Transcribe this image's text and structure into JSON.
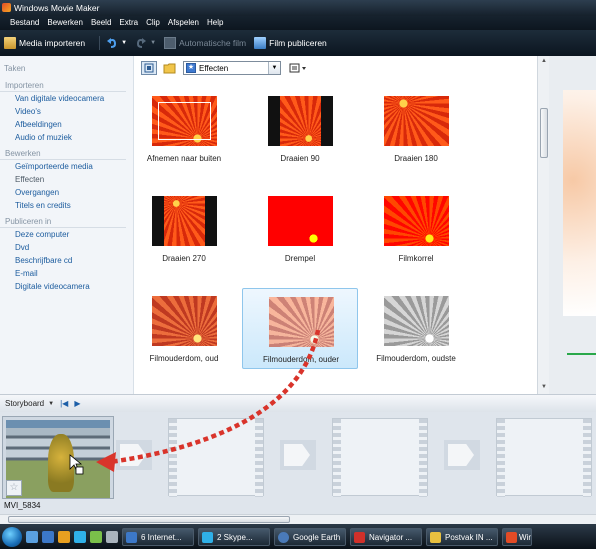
{
  "window": {
    "title": "Windows Movie Maker"
  },
  "menu": [
    "Bestand",
    "Bewerken",
    "Beeld",
    "Extra",
    "Clip",
    "Afspelen",
    "Help"
  ],
  "toolbar": {
    "import_label": "Media importeren",
    "auto_film_label": "Automatische film",
    "publish_label": "Film publiceren"
  },
  "taskpane": {
    "title": "Taken",
    "sections": [
      {
        "title": "Importeren",
        "items": [
          "Van digitale videocamera",
          "Video's",
          "Afbeeldingen",
          "Audio of muziek"
        ]
      },
      {
        "title": "Bewerken",
        "items": [
          "Geïmporteerde media",
          "Effecten",
          "Overgangen",
          "Titels en credits"
        ]
      },
      {
        "title": "Publiceren in",
        "items": [
          "Deze computer",
          "Dvd",
          "Beschrijfbare cd",
          "E-mail",
          "Digitale videocamera"
        ]
      }
    ]
  },
  "content": {
    "dropdown_value": "Effecten",
    "tiles": [
      "Afnemen naar buiten",
      "Draaien 90",
      "Draaien 180",
      "Draaien 270",
      "Drempel",
      "Filmkorrel",
      "Filmouderdom, oud",
      "Filmouderdom, ouder",
      "Filmouderdom, oudste"
    ],
    "selected_tile": "Filmouderdom, ouder"
  },
  "storyboard": {
    "label": "Storyboard",
    "clip_name": "MVI_5834"
  },
  "taskbar": {
    "buttons": [
      "6 Internet...",
      "2 Skype...",
      "Google Earth",
      "Navigator ...",
      "Postvak IN ...",
      "Windo..."
    ]
  },
  "icons": {
    "import": "import-icon",
    "undo": "undo-icon",
    "redo": "redo-icon",
    "auto_film": "auto-film-icon",
    "publish": "publish-icon",
    "effects": "star-icon",
    "play": "play-icon",
    "rewind": "rewind-icon"
  },
  "colors": {
    "accent": "#1c5c9e",
    "selection": "#cbe8fb",
    "arrow": "#d9342b"
  }
}
